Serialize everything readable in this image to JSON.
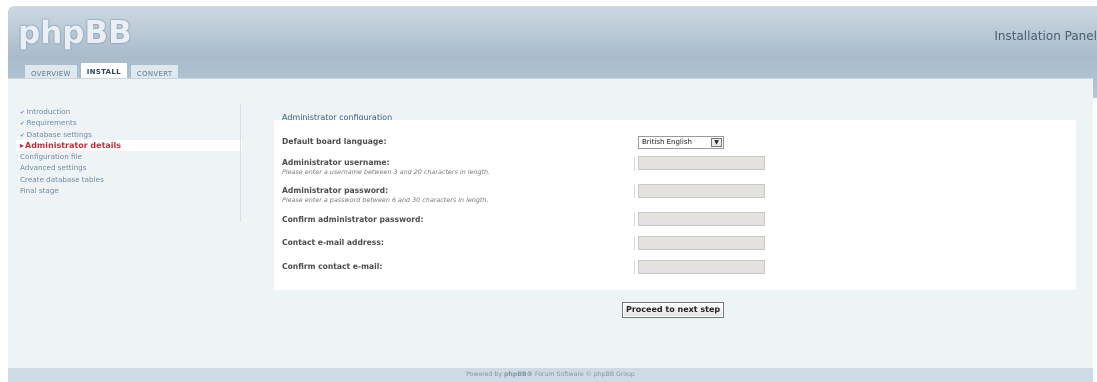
{
  "header": {
    "logo_text": "phpBB",
    "panel_title": "Installation Panel",
    "tabs": [
      {
        "label": "OVERVIEW"
      },
      {
        "label": "INSTALL"
      },
      {
        "label": "CONVERT"
      }
    ]
  },
  "sidebar": {
    "items": [
      {
        "label": "Introduction"
      },
      {
        "label": "Requirements"
      },
      {
        "label": "Database settings"
      },
      {
        "label": "Administrator details"
      },
      {
        "label": "Configuration file"
      },
      {
        "label": "Advanced settings"
      },
      {
        "label": "Create database tables"
      },
      {
        "label": "Final stage"
      }
    ]
  },
  "main": {
    "section_title": "Administrator configuration",
    "fields": [
      {
        "label": "Default board language:",
        "hint": ""
      },
      {
        "label": "Administrator username:",
        "hint": "Please enter a username between 3 and 20 characters in length.",
        "value": ""
      },
      {
        "label": "Administrator password:",
        "hint": "Please enter a password between 6 and 30 characters in length.",
        "value": ""
      },
      {
        "label": "Confirm administrator password:",
        "hint": "",
        "value": ""
      },
      {
        "label": "Contact e-mail address:",
        "hint": "",
        "value": ""
      },
      {
        "label": "Confirm contact e-mail:",
        "hint": "",
        "value": ""
      }
    ],
    "language_value": "British English",
    "submit_label": "Proceed to next step"
  },
  "footer": {
    "pre": "Powered by",
    "brand": "phpBB®",
    "post": "Forum Software © phpBB Group"
  },
  "colors": {
    "accent": "#bd2e3c",
    "header": "#a9bccb",
    "link": "#6f8aa1"
  }
}
